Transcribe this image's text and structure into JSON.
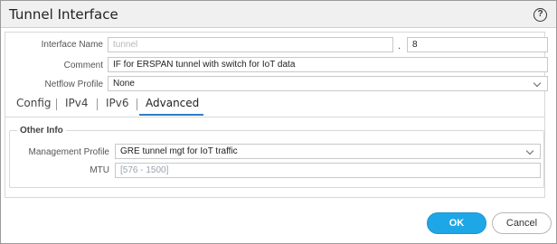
{
  "dialog": {
    "title": "Tunnel Interface",
    "help_glyph": "?"
  },
  "form": {
    "interface_name_label": "Interface Name",
    "interface_name_value": "tunnel",
    "interface_sep": ".",
    "interface_number": "8",
    "comment_label": "Comment",
    "comment_value": "IF for ERSPAN tunnel with switch for IoT data",
    "netflow_label": "Netflow Profile",
    "netflow_value": "None"
  },
  "tabs": [
    {
      "label": "Config",
      "active": false
    },
    {
      "label": "IPv4",
      "active": false
    },
    {
      "label": "IPv6",
      "active": false
    },
    {
      "label": "Advanced",
      "active": true
    }
  ],
  "other_info": {
    "legend": "Other Info",
    "management_profile_label": "Management Profile",
    "management_profile_value": "GRE tunnel mgt for IoT traffic",
    "mtu_label": "MTU",
    "mtu_placeholder": "[576 - 1500]"
  },
  "buttons": {
    "ok": "OK",
    "cancel": "Cancel"
  },
  "colors": {
    "accent": "#1ea7e6",
    "tab_underline": "#2a7fc9"
  }
}
